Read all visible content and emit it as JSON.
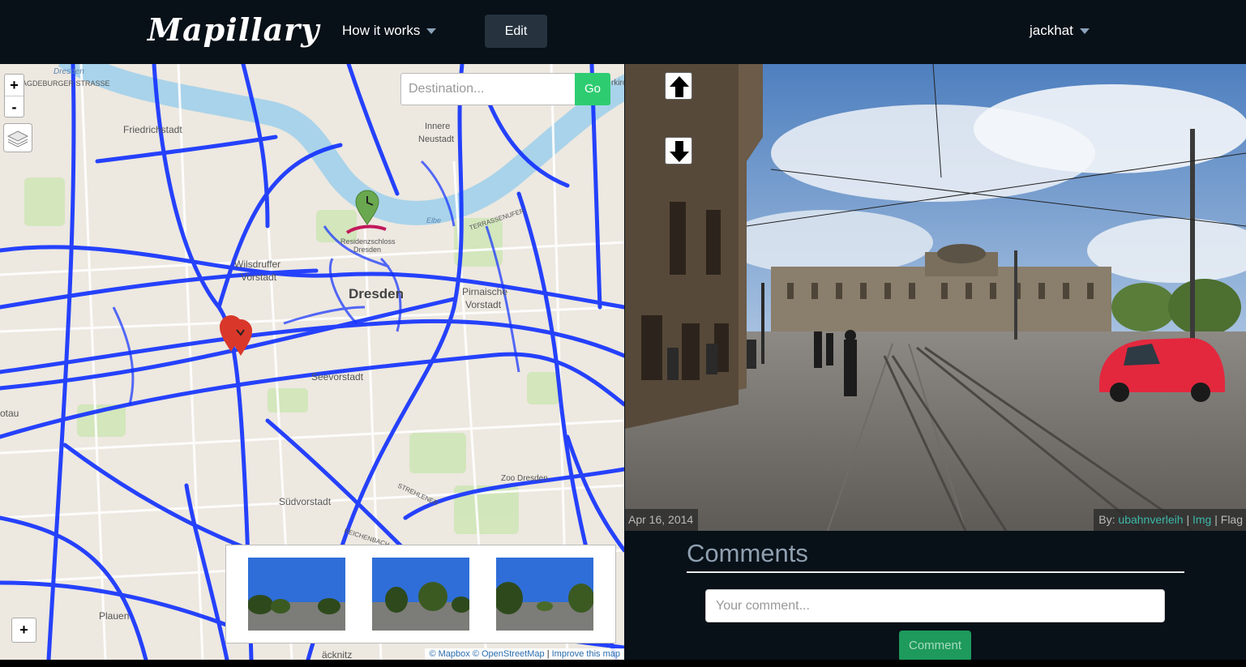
{
  "navbar": {
    "brand": "Mapillary",
    "how_it_works": "How it works",
    "edit_label": "Edit",
    "username": "jackhat"
  },
  "map": {
    "zoom_in": "+",
    "zoom_out": "-",
    "destination_placeholder": "Destination...",
    "go_label": "Go",
    "thumb_zoom": "+",
    "labels": {
      "magdeburger": "AGDEBURGER STRASSE",
      "dresden_top": "Dresden",
      "friedrichstadt": "Friedrichstadt",
      "innere_neustadt_1": "Innere",
      "innere_neustadt_2": "Neustadt",
      "terrassenufer": "TERRASSENUFER",
      "residenzschloss_1": "Residenzschloss",
      "residenzschloss_2": "Dresden",
      "wilsdruffer_1": "Wilsdruffer",
      "wilsdruffer_2": "Vorstadt",
      "dresden_center": "Dresden",
      "pirnaische_1": "Pirnaische",
      "pirnaische_2": "Vorstadt",
      "seevorstadt": "Seevorstadt",
      "zoo": "Zoo Dresden",
      "suedvorstadt": "Südvorstadt",
      "strehlener": "STREHLENER",
      "reichenbach": "REICHENBACH",
      "plauen": "Plauen",
      "racknitz": "äcknitz",
      "otau": "otau",
      "elbe": "Elbe",
      "kirchen": "rkirchen"
    },
    "attribution": {
      "mapbox": "© Mapbox",
      "osm": "© OpenStreetMap",
      "separator": "|",
      "improve": "Improve this map"
    }
  },
  "photo": {
    "date": "Apr 16, 2014",
    "by_label": "By:",
    "author": "ubahnverleih",
    "img_link": "Img",
    "separator": "|",
    "flag": "Flag"
  },
  "comments": {
    "title": "Comments",
    "placeholder": "Your comment...",
    "submit_label": "Comment"
  },
  "colors": {
    "navbar_bg": "#081018",
    "route_blue": "#1030ff",
    "go_green": "#2ecc71",
    "comment_green": "#1e9a5c",
    "marker_green": "#6aa84f",
    "marker_red": "#d9372a"
  }
}
